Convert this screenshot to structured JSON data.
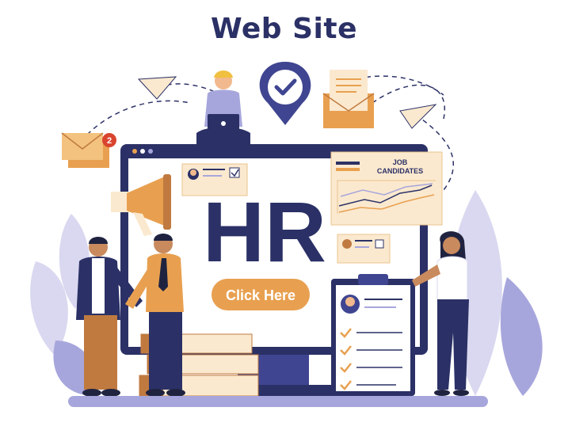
{
  "header": {
    "title": "Web Site"
  },
  "monitor": {
    "heading": "HR",
    "cta_label": "Click Here"
  },
  "chart_panel": {
    "title_line1": "JOB",
    "title_line2": "CANDIDATES"
  },
  "notification": {
    "badge_count": "2"
  },
  "colors": {
    "navy": "#2b3166",
    "accent_orange": "#e8a050",
    "lavender": "#a7a6dc",
    "light_lavender": "#d9d8f0",
    "cream": "#fbe9cf",
    "brown": "#c07a40"
  }
}
